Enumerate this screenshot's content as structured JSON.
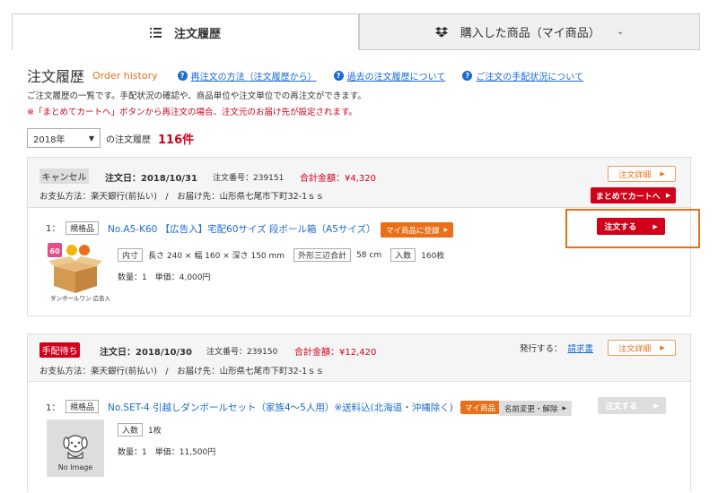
{
  "tabs": [
    {
      "label": "注文履歴",
      "icon": "list-icon",
      "active": true
    },
    {
      "label": "購入した商品（マイ商品）",
      "icon": "dropbox-icon",
      "active": false
    }
  ],
  "page": {
    "title": "注文履歴",
    "title_en": "Order history",
    "help_links": [
      "再注文の方法（注文履歴から）",
      "過去の注文履歴について",
      "ご注文の手配状況について"
    ],
    "desc1": "ご注文履歴の一覧です。手配状況の確認や、商品単位や注文単位での再注文ができます。",
    "desc2": "※「まとめてカートへ」ボタンから再注文の場合、注文元のお届け先が設定されます。"
  },
  "filter": {
    "year": "2018年",
    "label": "の注文履歴",
    "count": "116件"
  },
  "orders": [
    {
      "status": "キャンセル",
      "date_label": "注文日：2018/10/31",
      "number_label": "注文番号：239151",
      "total_label": "合計金額：¥4,320",
      "payment": "お支払方法：楽天銀行(前払い)　/　お届け先：山形県七尾市下町32-1ｓｓ",
      "detail_btn": "注文詳細",
      "cart_btn": "まとめてカートへ",
      "item": {
        "index": "1：",
        "tag": "規格品",
        "name": "No.A5-K60 【広告入】宅配60サイズ 段ボール箱（A5サイズ）",
        "my_btn": "マイ商品に登録",
        "specs": [
          {
            "tag": "内寸",
            "value": "長さ 240 × 幅 160 × 深さ 150 mm"
          },
          {
            "tag": "外形三辺合計",
            "value": "58 cm"
          },
          {
            "tag": "入数",
            "value": "160枚"
          }
        ],
        "qty": "数量：1　単価：4,000円",
        "order_btn": "注文する",
        "thumb_text": "ダンボールワン 広告入"
      }
    },
    {
      "status": "手配待ち",
      "date_label": "注文日：2018/10/30",
      "number_label": "注文番号：239150",
      "total_label": "合計金額：¥12,420",
      "payment": "お支払方法：楽天銀行(前払い)　/　お届け先：山形県七尾市下町32-1ｓｓ",
      "issue_label": "発行する：",
      "issue_link": "請求書",
      "detail_btn": "注文詳細",
      "item": {
        "index": "1：",
        "tag": "規格品",
        "name": "No.SET-4 引越しダンボールセット（家族4～5人用）※送料込(北海道・沖縄除く)",
        "my_badge": "マイ商品",
        "change_btn": "名前変更・解除",
        "specs": [
          {
            "tag": "入数",
            "value": "1枚"
          }
        ],
        "qty": "数量：1　単価：11,500円",
        "order_btn": "注文する",
        "thumb_text": "No Image"
      }
    }
  ],
  "colors": {
    "accent": "#e8701a",
    "red": "#d0021b",
    "link": "#1a6bd0"
  }
}
